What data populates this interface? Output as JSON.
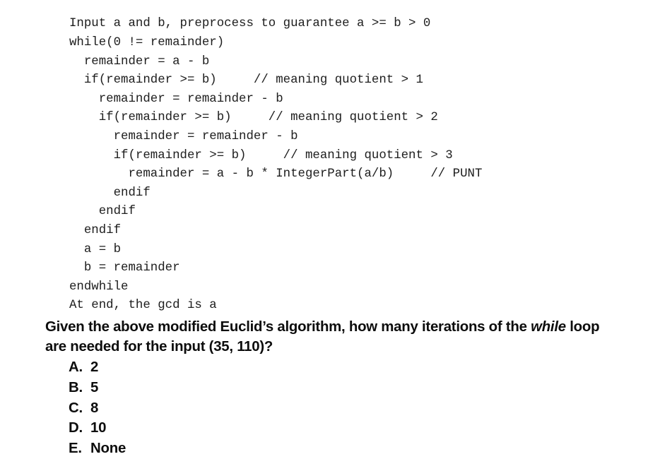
{
  "algorithm": {
    "lines": [
      "Input a and b, preprocess to guarantee a >= b > 0",
      "while(0 != remainder)",
      "  remainder = a - b",
      "  if(remainder >= b)     // meaning quotient > 1",
      "    remainder = remainder - b",
      "    if(remainder >= b)     // meaning quotient > 2",
      "      remainder = remainder - b",
      "      if(remainder >= b)     // meaning quotient > 3",
      "        remainder = a - b * IntegerPart(a/b)     // PUNT",
      "      endif",
      "    endif",
      "  endif",
      "  a = b",
      "  b = remainder",
      "endwhile",
      "At end, the gcd is a"
    ]
  },
  "question": {
    "part1": "Given the above modified Euclid’s algorithm, how many iterations of the ",
    "emphasis": "while",
    "part2": " loop are needed for the input (35, 110)?"
  },
  "options": [
    {
      "letter": "A.",
      "value": "2"
    },
    {
      "letter": "B.",
      "value": "5"
    },
    {
      "letter": "C.",
      "value": "8"
    },
    {
      "letter": "D.",
      "value": "10"
    },
    {
      "letter": "E.",
      "value": "None"
    }
  ],
  "colors": {
    "background": "#ffffff",
    "code_text": "#1d1d1d",
    "question_text": "#0d0d0d"
  }
}
